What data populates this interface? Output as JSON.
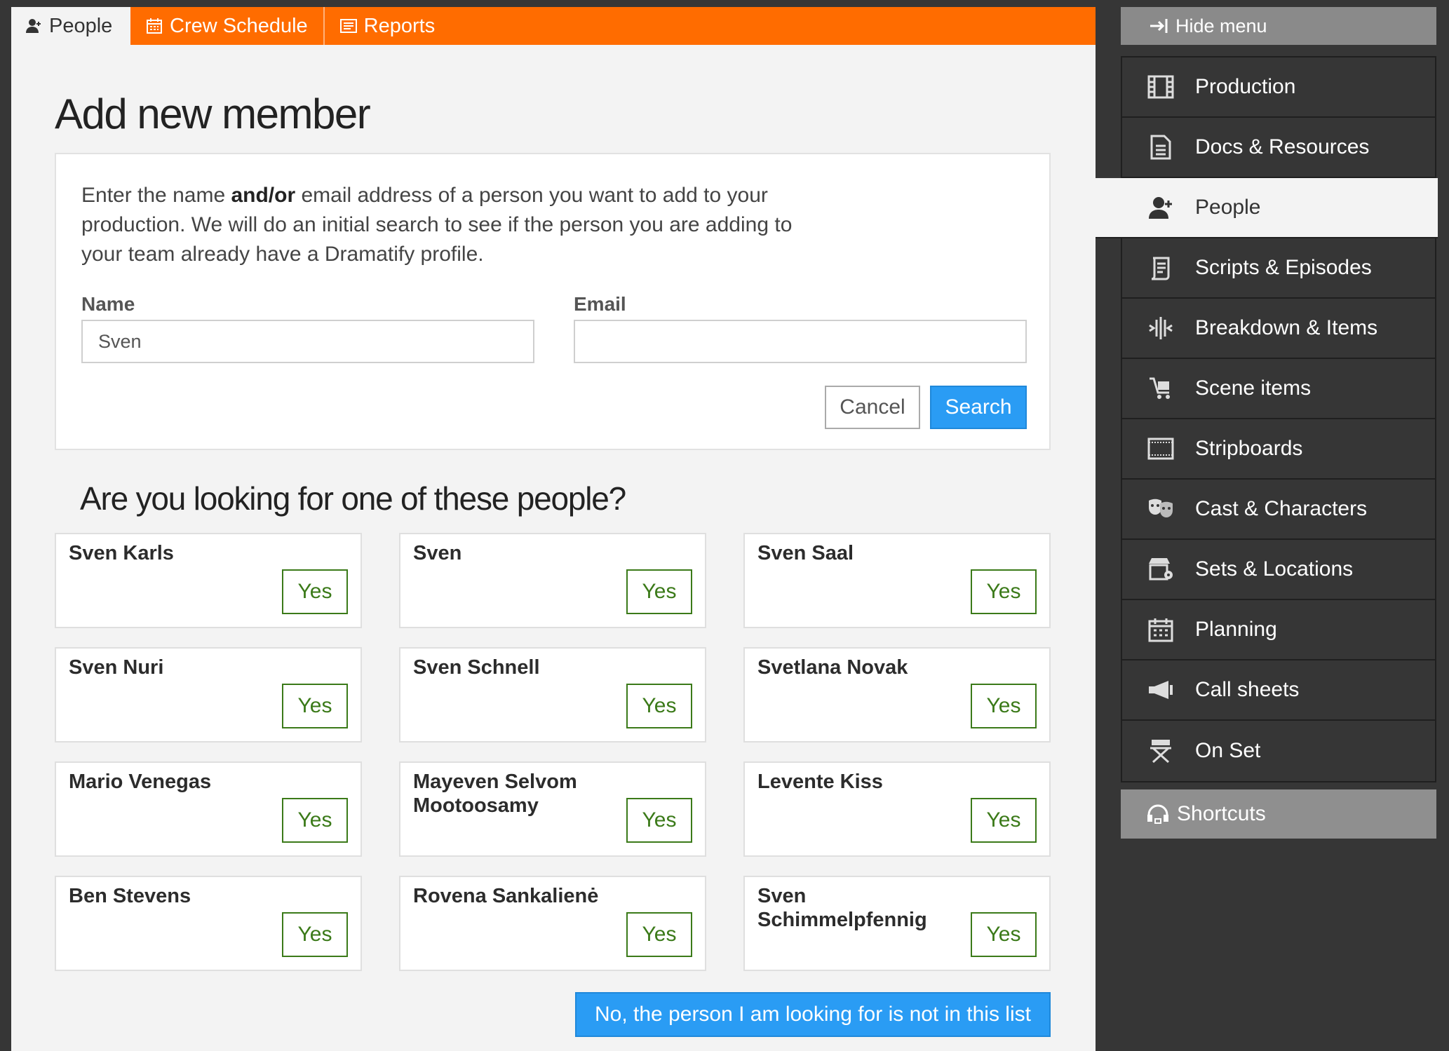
{
  "tabs": [
    {
      "label": "People",
      "icon": "person-icon"
    },
    {
      "label": "Crew Schedule",
      "icon": "calendar-icon"
    },
    {
      "label": "Reports",
      "icon": "report-icon"
    }
  ],
  "page_title": "Add new member",
  "intro": {
    "before": "Enter the name ",
    "bold": "and/or",
    "after": " email address of a person you want to add to your production. We will do an initial search to see if the person you are adding to your team already have a Dramatify profile."
  },
  "form": {
    "name_label": "Name",
    "name_value": "Sven",
    "email_label": "Email",
    "email_value": "",
    "cancel_label": "Cancel",
    "search_label": "Search"
  },
  "question_title": "Are you looking for one of these people?",
  "yes_label": "Yes",
  "people": [
    "Sven Karls",
    "Sven",
    "Sven Saal",
    "Sven Nuri",
    "Sven Schnell",
    "Svetlana Novak",
    "Mario Venegas",
    "Mayeven Selvom Mootoosamy",
    "Levente Kiss",
    "Ben Stevens",
    "Rovena Sankalienė",
    "Sven Schimmelpfennig"
  ],
  "not_in_list_label": "No, the person I am looking for is not in this list",
  "sidebar": {
    "hide_menu_label": "Hide menu",
    "items": [
      {
        "label": "Production",
        "icon": "film-icon"
      },
      {
        "label": "Docs & Resources",
        "icon": "document-icon"
      },
      {
        "label": "People",
        "icon": "person-icon",
        "active": true
      },
      {
        "label": "Scripts & Episodes",
        "icon": "script-icon"
      },
      {
        "label": "Breakdown & Items",
        "icon": "breakdown-icon"
      },
      {
        "label": "Scene items",
        "icon": "cart-icon"
      },
      {
        "label": "Stripboards",
        "icon": "stripboard-icon"
      },
      {
        "label": "Cast & Characters",
        "icon": "masks-icon"
      },
      {
        "label": "Sets & Locations",
        "icon": "location-icon"
      },
      {
        "label": "Planning",
        "icon": "calendar-icon"
      },
      {
        "label": "Call sheets",
        "icon": "megaphone-icon"
      },
      {
        "label": "On Set",
        "icon": "director-chair-icon"
      }
    ],
    "shortcuts_label": "Shortcuts"
  },
  "colors": {
    "accent_orange": "#ff6c00",
    "primary_blue": "#2a9cf4",
    "yes_green": "#3b7a19",
    "sidebar_bg": "#363636"
  }
}
